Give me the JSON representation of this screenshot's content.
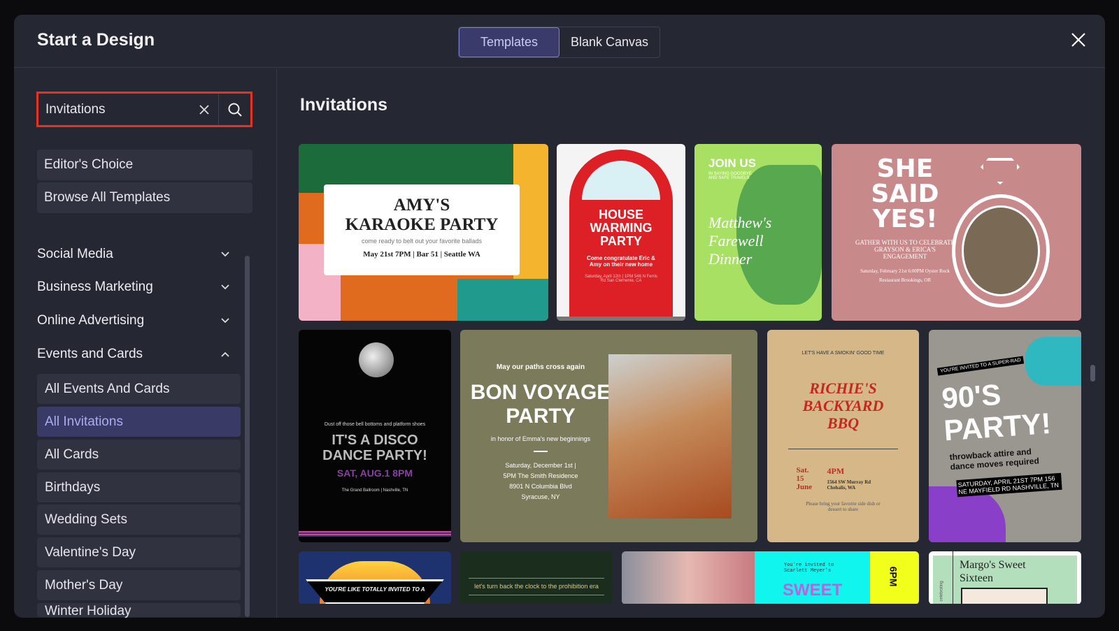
{
  "header": {
    "title": "Start a Design",
    "tabs": [
      {
        "label": "Templates",
        "active": true
      },
      {
        "label": "Blank Canvas",
        "active": false
      }
    ]
  },
  "search": {
    "value": "Invitations"
  },
  "sidebar": {
    "top_buttons": [
      "Editor's Choice",
      "Browse All Templates"
    ],
    "categories": [
      {
        "label": "Social Media",
        "expanded": false
      },
      {
        "label": "Business Marketing",
        "expanded": false
      },
      {
        "label": "Online Advertising",
        "expanded": false
      },
      {
        "label": "Events and Cards",
        "expanded": true
      }
    ],
    "sub_items": [
      "All Events And Cards",
      "All Invitations",
      "All Cards",
      "Birthdays",
      "Wedding Sets",
      "Valentine's Day",
      "Mother's Day",
      "Winter Holiday"
    ],
    "selected": "All Invitations"
  },
  "main": {
    "heading": "Invitations",
    "cards": {
      "karaoke": {
        "title1": "AMY'S",
        "title2": "KARAOKE PARTY",
        "sub": "come ready to belt out your favorite ballads",
        "details": "May 21st 7PM | Bar 51 | Seattle WA"
      },
      "house": {
        "title": "HOUSE WARMING PARTY",
        "sub": "Come congratulate Eric & Amy on their new home",
        "details": "Saturday, April 12th | 1PM 546 N Ferris Rd San Clemente, CA"
      },
      "farewell": {
        "title": "JOIN US",
        "sub": "IN SAYING GOODBYE AND SAFE TRAVELS",
        "script": "Matthew's Farewell Dinner"
      },
      "engagement": {
        "title": "SHE SAID YES!",
        "sub": "GATHER WITH US TO CELEBRATE GRAYSON & ERICA'S ENGAGEMENT",
        "details": "Saturday, February 21st 6:00PM Oyster Rock Restaurant Brookings, OR"
      },
      "disco": {
        "sub": "Dust off those bell bottoms and platform shoes",
        "title": "IT'S A DISCO DANCE PARTY!",
        "date": "SAT, AUG.1 8PM",
        "venue": "The Grand Ballroom | Nashville, TN"
      },
      "voyage": {
        "kicker": "May our paths cross again",
        "title": "BON VOYAGE PARTY",
        "sub": "in honor of Emma's new beginnings",
        "details": "Saturday, December 1st | 5PM The Smith Residence 8901 N Columbia Blvd Syracuse, NY"
      },
      "bbq": {
        "kicker": "LET'S HAVE A SMOKIN' GOOD TIME",
        "title": "RICHIE'S BACKYARD BBQ",
        "date": "Sat. 15 June",
        "time": "4PM",
        "address": "1564 SW Murray Rd Chehalis, WA",
        "note": "Please bring your favorite side dish or dessert to share"
      },
      "nineties": {
        "kicker": "YOU'RE INVITED TO A SUPER-RAD",
        "title": "90'S PARTY!",
        "sub": "throwback attire and dance moves required",
        "details": "SATURDAY, APRIL 21ST 7PM 156 NE MAYFIELD RD NASHVILLE, TN"
      },
      "eighties": {
        "kicker": "YOU'RE LIKE TOTALLY INVITED TO A"
      },
      "prohibition": {
        "sub": "let's turn back the clock to the prohibition era"
      },
      "sweet": {
        "sub": "You're invited to Scarlett Meyer's",
        "title": "SWEET",
        "time": "6PM"
      },
      "margo": {
        "title": "Margo's Sweet Sixteen",
        "side": "celebrating"
      }
    }
  },
  "colors": {
    "accent": "#7c80d8",
    "highlight": "#e8321f",
    "bg": "#252733"
  }
}
